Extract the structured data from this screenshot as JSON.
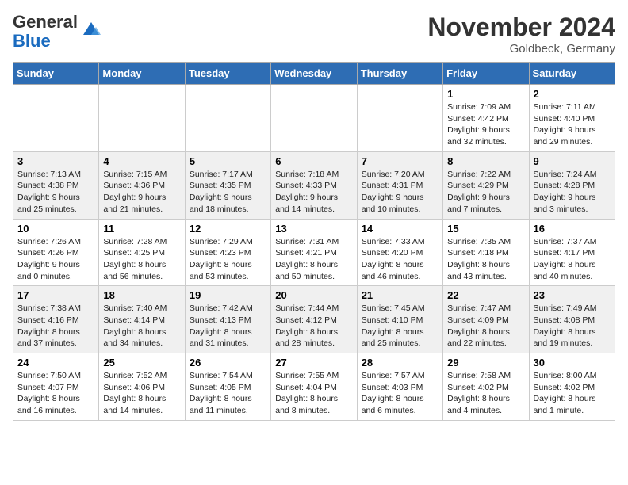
{
  "header": {
    "logo_general": "General",
    "logo_blue": "Blue",
    "month_title": "November 2024",
    "location": "Goldbeck, Germany"
  },
  "weekdays": [
    "Sunday",
    "Monday",
    "Tuesday",
    "Wednesday",
    "Thursday",
    "Friday",
    "Saturday"
  ],
  "weeks": [
    [
      {
        "day": "",
        "info": ""
      },
      {
        "day": "",
        "info": ""
      },
      {
        "day": "",
        "info": ""
      },
      {
        "day": "",
        "info": ""
      },
      {
        "day": "",
        "info": ""
      },
      {
        "day": "1",
        "info": "Sunrise: 7:09 AM\nSunset: 4:42 PM\nDaylight: 9 hours\nand 32 minutes."
      },
      {
        "day": "2",
        "info": "Sunrise: 7:11 AM\nSunset: 4:40 PM\nDaylight: 9 hours\nand 29 minutes."
      }
    ],
    [
      {
        "day": "3",
        "info": "Sunrise: 7:13 AM\nSunset: 4:38 PM\nDaylight: 9 hours\nand 25 minutes."
      },
      {
        "day": "4",
        "info": "Sunrise: 7:15 AM\nSunset: 4:36 PM\nDaylight: 9 hours\nand 21 minutes."
      },
      {
        "day": "5",
        "info": "Sunrise: 7:17 AM\nSunset: 4:35 PM\nDaylight: 9 hours\nand 18 minutes."
      },
      {
        "day": "6",
        "info": "Sunrise: 7:18 AM\nSunset: 4:33 PM\nDaylight: 9 hours\nand 14 minutes."
      },
      {
        "day": "7",
        "info": "Sunrise: 7:20 AM\nSunset: 4:31 PM\nDaylight: 9 hours\nand 10 minutes."
      },
      {
        "day": "8",
        "info": "Sunrise: 7:22 AM\nSunset: 4:29 PM\nDaylight: 9 hours\nand 7 minutes."
      },
      {
        "day": "9",
        "info": "Sunrise: 7:24 AM\nSunset: 4:28 PM\nDaylight: 9 hours\nand 3 minutes."
      }
    ],
    [
      {
        "day": "10",
        "info": "Sunrise: 7:26 AM\nSunset: 4:26 PM\nDaylight: 9 hours\nand 0 minutes."
      },
      {
        "day": "11",
        "info": "Sunrise: 7:28 AM\nSunset: 4:25 PM\nDaylight: 8 hours\nand 56 minutes."
      },
      {
        "day": "12",
        "info": "Sunrise: 7:29 AM\nSunset: 4:23 PM\nDaylight: 8 hours\nand 53 minutes."
      },
      {
        "day": "13",
        "info": "Sunrise: 7:31 AM\nSunset: 4:21 PM\nDaylight: 8 hours\nand 50 minutes."
      },
      {
        "day": "14",
        "info": "Sunrise: 7:33 AM\nSunset: 4:20 PM\nDaylight: 8 hours\nand 46 minutes."
      },
      {
        "day": "15",
        "info": "Sunrise: 7:35 AM\nSunset: 4:18 PM\nDaylight: 8 hours\nand 43 minutes."
      },
      {
        "day": "16",
        "info": "Sunrise: 7:37 AM\nSunset: 4:17 PM\nDaylight: 8 hours\nand 40 minutes."
      }
    ],
    [
      {
        "day": "17",
        "info": "Sunrise: 7:38 AM\nSunset: 4:16 PM\nDaylight: 8 hours\nand 37 minutes."
      },
      {
        "day": "18",
        "info": "Sunrise: 7:40 AM\nSunset: 4:14 PM\nDaylight: 8 hours\nand 34 minutes."
      },
      {
        "day": "19",
        "info": "Sunrise: 7:42 AM\nSunset: 4:13 PM\nDaylight: 8 hours\nand 31 minutes."
      },
      {
        "day": "20",
        "info": "Sunrise: 7:44 AM\nSunset: 4:12 PM\nDaylight: 8 hours\nand 28 minutes."
      },
      {
        "day": "21",
        "info": "Sunrise: 7:45 AM\nSunset: 4:10 PM\nDaylight: 8 hours\nand 25 minutes."
      },
      {
        "day": "22",
        "info": "Sunrise: 7:47 AM\nSunset: 4:09 PM\nDaylight: 8 hours\nand 22 minutes."
      },
      {
        "day": "23",
        "info": "Sunrise: 7:49 AM\nSunset: 4:08 PM\nDaylight: 8 hours\nand 19 minutes."
      }
    ],
    [
      {
        "day": "24",
        "info": "Sunrise: 7:50 AM\nSunset: 4:07 PM\nDaylight: 8 hours\nand 16 minutes."
      },
      {
        "day": "25",
        "info": "Sunrise: 7:52 AM\nSunset: 4:06 PM\nDaylight: 8 hours\nand 14 minutes."
      },
      {
        "day": "26",
        "info": "Sunrise: 7:54 AM\nSunset: 4:05 PM\nDaylight: 8 hours\nand 11 minutes."
      },
      {
        "day": "27",
        "info": "Sunrise: 7:55 AM\nSunset: 4:04 PM\nDaylight: 8 hours\nand 8 minutes."
      },
      {
        "day": "28",
        "info": "Sunrise: 7:57 AM\nSunset: 4:03 PM\nDaylight: 8 hours\nand 6 minutes."
      },
      {
        "day": "29",
        "info": "Sunrise: 7:58 AM\nSunset: 4:02 PM\nDaylight: 8 hours\nand 4 minutes."
      },
      {
        "day": "30",
        "info": "Sunrise: 8:00 AM\nSunset: 4:02 PM\nDaylight: 8 hours\nand 1 minute."
      }
    ]
  ]
}
